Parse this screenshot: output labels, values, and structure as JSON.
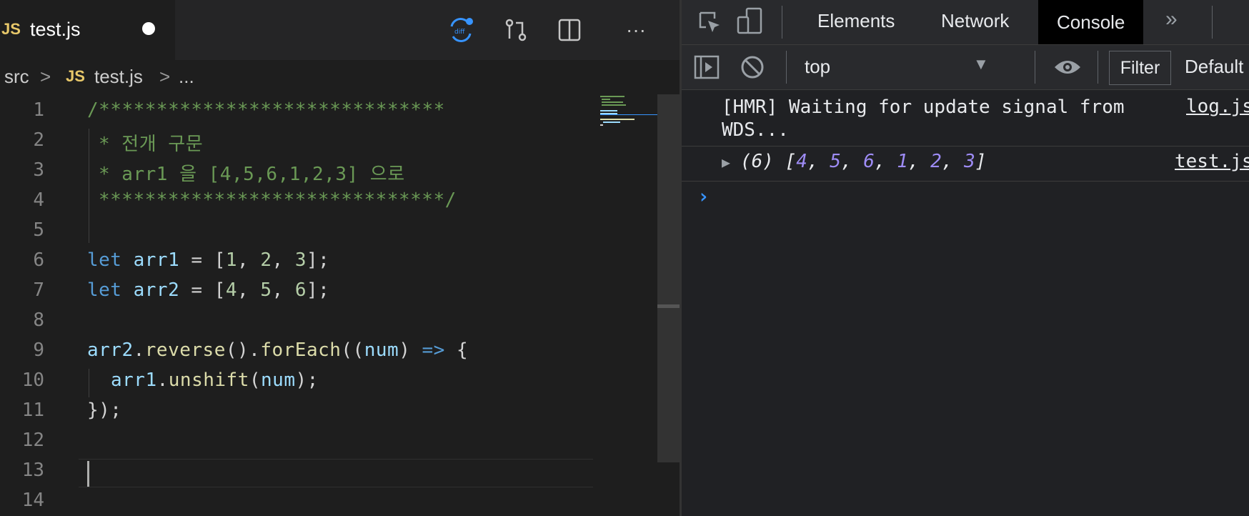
{
  "editor": {
    "tab": {
      "lang_badge": "JS",
      "filename": "test.js"
    },
    "breadcrumb": {
      "folder": "src",
      "sep1": ">",
      "lang_badge": "JS",
      "file": "test.js",
      "sep2": ">",
      "more": "..."
    },
    "line_numbers": [
      "1",
      "2",
      "3",
      "4",
      "5",
      "6",
      "7",
      "8",
      "9",
      "10",
      "11",
      "12",
      "13",
      "14"
    ],
    "code": {
      "l1": "/******************************",
      "l2": "* 전개 구문",
      "l3": "* arr1 을 [4,5,6,1,2,3] 으로",
      "l4": "******************************/",
      "l6": {
        "kw": "let",
        "var": "arr1",
        "eq": " = ",
        "open": "[",
        "n1": "1",
        "c1": ", ",
        "n2": "2",
        "c2": ", ",
        "n3": "3",
        "close": "];"
      },
      "l7": {
        "kw": "let",
        "var": "arr2",
        "eq": " = ",
        "open": "[",
        "n1": "4",
        "c1": ", ",
        "n2": "5",
        "c2": ", ",
        "n3": "6",
        "close": "];"
      },
      "l9": {
        "var": "arr2",
        "dot1": ".",
        "fn1": "reverse",
        "p1": "().",
        "fn2": "forEach",
        "p2": "((",
        "param": "num",
        "p3": ") ",
        "arrow": "=>",
        "p4": " {"
      },
      "l10": {
        "var": "arr1",
        "dot": ".",
        "fn": "unshift",
        "p1": "(",
        "param": "num",
        "p2": ");"
      },
      "l11": "});"
    }
  },
  "devtools": {
    "tabs": {
      "elements": "Elements",
      "network": "Network",
      "console": "Console",
      "more": "»"
    },
    "toolbar": {
      "context": "top",
      "filter": "Filter",
      "levels": "Default"
    },
    "console": {
      "row1": {
        "line1": "[HMR] Waiting for update signal from",
        "line2": "WDS...",
        "source": "log.js"
      },
      "row2": {
        "count": "(6)",
        "open": "[",
        "values": [
          "4",
          "5",
          "6",
          "1",
          "2",
          "3"
        ],
        "close": "]",
        "source": "test.js"
      },
      "prompt": "›"
    }
  },
  "colors": {
    "comment": "#6a9955",
    "keyword": "#569cd6",
    "variable": "#9cdcfe",
    "function": "#dcdcaa",
    "number": "#b5cea8",
    "console_number": "#9e8cf6"
  }
}
